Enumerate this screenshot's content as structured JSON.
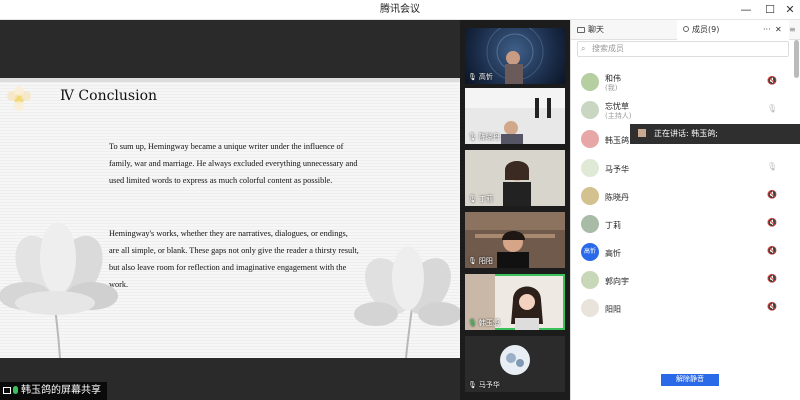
{
  "window": {
    "title": "腾讯会议",
    "minimize_glyph": "—",
    "maximize_glyph": "☐",
    "close_glyph": "✕"
  },
  "slide": {
    "heading": "Ⅳ  Conclusion",
    "paragraph1": "To sum up, Hemingway became a unique writer under the influence of family, war and marriage. He always excluded everything unnecessary and used limited words to express as much colorful content as possible.",
    "paragraph2": " Hemingway's works, whether they are narratives, dialogues, or endings, are all simple, or blank. These gaps not only give the reader a thirsty result, but also leave room for reflection and imaginative engagement with the work."
  },
  "share": {
    "label": "韩玉鸽的屏幕共享"
  },
  "videos": [
    {
      "name": "高忻"
    },
    {
      "name": "陈晓丹"
    },
    {
      "name": "丁莉"
    },
    {
      "name": "阳阳"
    },
    {
      "name": "韩玉鸽"
    },
    {
      "name": "马予华"
    }
  ],
  "panel": {
    "tab_chat": "聊天",
    "tab_members": "成员(9)",
    "more_glyph": "···",
    "close_glyph": "✕",
    "menu_glyph": "≡",
    "search_placeholder": "搜索成员",
    "speaking_text": "正在讲话: 韩玉鸽;",
    "unmute_all": "解除静音"
  },
  "members": [
    {
      "name": "和伟",
      "role": "(我)",
      "avatar": "",
      "muted": true
    },
    {
      "name": "忘忧草",
      "role": "(主持人)",
      "avatar": "",
      "muted": false
    },
    {
      "name": "韩玉鸽",
      "role": "",
      "avatar": "",
      "muted": false
    },
    {
      "name": "马予华",
      "role": "",
      "avatar": "",
      "muted": false
    },
    {
      "name": "陈晓丹",
      "role": "",
      "avatar": "",
      "muted": true
    },
    {
      "name": "丁莉",
      "role": "",
      "avatar": "",
      "muted": true
    },
    {
      "name": "高忻",
      "role": "",
      "avatar": "高忻",
      "muted": true
    },
    {
      "name": "郭向宇",
      "role": "",
      "avatar": "",
      "muted": true
    },
    {
      "name": "阳阳",
      "role": "",
      "avatar": "",
      "muted": true
    }
  ],
  "colors": {
    "accent": "#2a6ae8",
    "active_speaker": "#3ac15a",
    "muted": "#e38b8b"
  }
}
